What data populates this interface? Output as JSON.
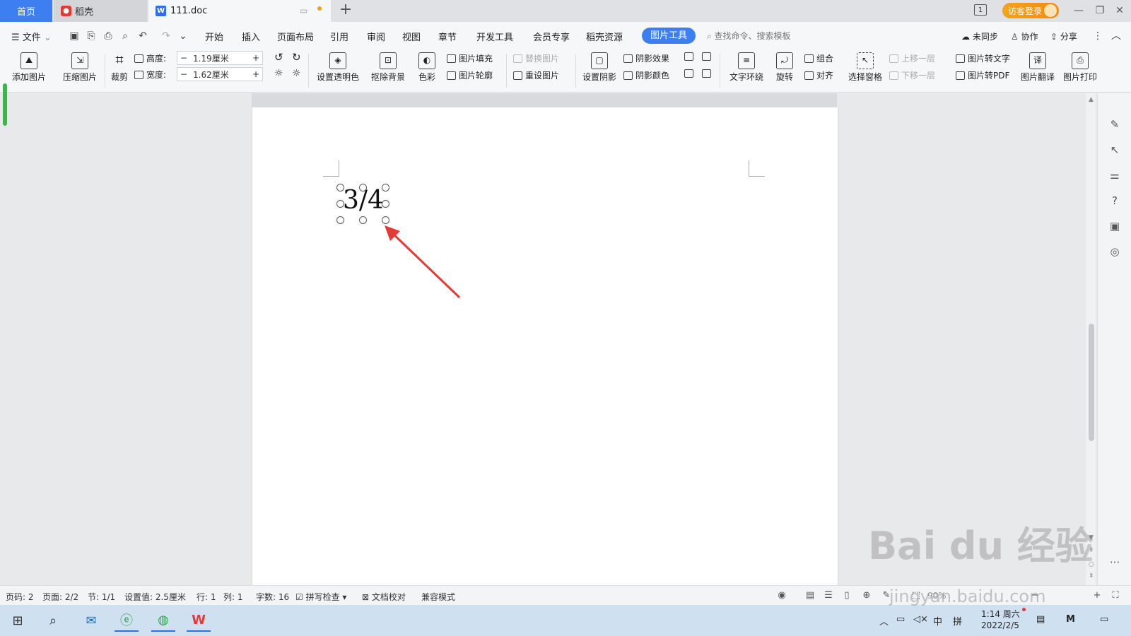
{
  "tabs": {
    "home": "首页",
    "daoke": "稻壳",
    "doc": "111.doc",
    "add": "+",
    "login": "访客登录"
  },
  "menu": {
    "file": "文件",
    "items": [
      "开始",
      "插入",
      "页面布局",
      "引用",
      "审阅",
      "视图",
      "章节",
      "开发工具",
      "会员专享",
      "稻壳资源"
    ],
    "pic_tools": "图片工具",
    "search_placeholder": "查找命令、搜索模板",
    "sync": "未同步",
    "collab": "协作",
    "share": "分享"
  },
  "ribbon": {
    "add_pic": "添加图片",
    "compress": "压缩图片",
    "crop": "裁剪",
    "height_label": "高度:",
    "height_value": "1.19厘米",
    "width_label": "宽度:",
    "width_value": "1.62厘米",
    "minus": "−",
    "plus": "+",
    "set_transparent": "设置透明色",
    "remove_bg": "抠除背景",
    "color": "色彩",
    "pic_fill": "图片填充",
    "pic_outline": "图片轮廓",
    "replace_pic": "替换图片",
    "reset_pic": "重设图片",
    "set_shadow": "设置阴影",
    "shadow_effect": "阴影效果",
    "shadow_color": "阴影颜色",
    "text_wrap": "文字环绕",
    "rotate": "旋转",
    "group": "组合",
    "align": "对齐",
    "select_pane": "选择窗格",
    "bring_forward": "上移一层",
    "send_backward": "下移一层",
    "pic_to_text": "图片转文字",
    "pic_to_pdf": "图片转PDF",
    "pic_translate": "图片翻译",
    "pic_print": "图片打印"
  },
  "document": {
    "formula": "3/4"
  },
  "status": {
    "page_code": "页码: 2",
    "page": "页面: 2/2",
    "section": "节: 1/1",
    "setting": "设置值: 2.5厘米",
    "row": "行: 1",
    "col": "列: 1",
    "word_count": "字数: 16",
    "spell_check": "拼写检查",
    "doc_proof": "文档校对",
    "compat_mode": "兼容模式",
    "zoom": "90%"
  },
  "taskbar": {
    "ime_zh": "中",
    "ime_pin": "拼",
    "time": "1:14 周六",
    "date": "2022/2/5"
  },
  "watermark": {
    "brand": "Bai du 经验",
    "url": "jingyan.baidu.com"
  },
  "colors": {
    "accent": "#3d7ff0",
    "login": "#f39c12",
    "arrow": "#e53935"
  }
}
